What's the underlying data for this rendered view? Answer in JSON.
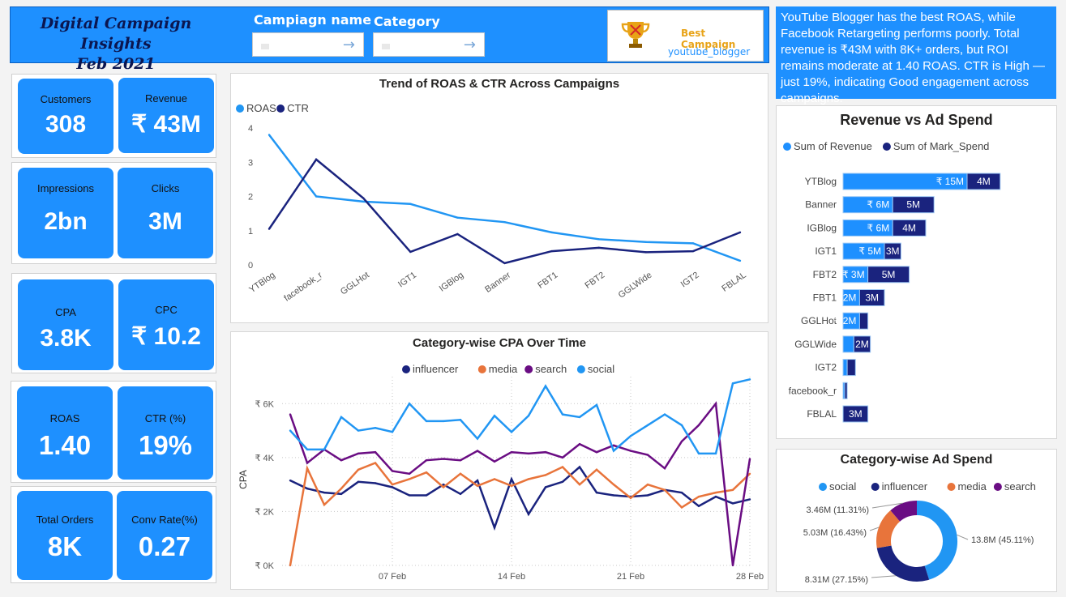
{
  "header": {
    "title_line1": "Digital Campaign Insights",
    "title_line2": "Feb 2021",
    "slicer_campaign_label": "Campiagn name",
    "slicer_category_label": "Category",
    "best_campaign_label": "Best Campaign",
    "best_campaign_value": "youtube_blogger"
  },
  "insight_text": "YouTube Blogger has the best ROAS, while Facebook Retargeting performs poorly. Total revenue is ₹43M with 8K+ orders, but ROI remains moderate at 1.40 ROAS. CTR is High — just 19%, indicating Good engagement across campaigns.",
  "kpis": {
    "customers": {
      "label": "Customers",
      "value": "308"
    },
    "revenue": {
      "label": "Revenue",
      "value": "₹ 43M"
    },
    "impressions": {
      "label": "Impressions",
      "value": "2bn"
    },
    "clicks": {
      "label": "Clicks",
      "value": "3M"
    },
    "cpa": {
      "label": "CPA",
      "value": "3.8K"
    },
    "cpc": {
      "label": "CPC",
      "value": "₹ 10.2"
    },
    "roas": {
      "label": "ROAS",
      "value": "1.40"
    },
    "ctr": {
      "label": "CTR (%)",
      "value": "19%"
    },
    "orders": {
      "label": "Total Orders",
      "value": "8K"
    },
    "conv": {
      "label": "Conv Rate(%)",
      "value": "0.27"
    }
  },
  "colors": {
    "accent": "#1e90ff",
    "dark_blue": "#1a237e",
    "orange": "#e8743b",
    "purple": "#6a0d83",
    "light_blue": "#2196f3"
  },
  "chart_data": [
    {
      "type": "line",
      "title": "Trend of ROAS & CTR Across Campaigns",
      "categories": [
        "YTBlog",
        "facebook_r",
        "GGLHot",
        "IGT1",
        "IGBlog",
        "Banner",
        "FBT1",
        "FBT2",
        "GGLWide",
        "IGT2",
        "FBLAL"
      ],
      "series": [
        {
          "name": "ROAS",
          "color": "#2196f3",
          "values": [
            3.8,
            2.0,
            1.85,
            1.78,
            1.38,
            1.25,
            0.95,
            0.75,
            0.67,
            0.63,
            0.12
          ]
        },
        {
          "name": "CTR",
          "color": "#1a237e",
          "values": [
            1.05,
            3.08,
            1.95,
            0.38,
            0.9,
            0.05,
            0.4,
            0.5,
            0.37,
            0.4,
            0.95
          ]
        }
      ],
      "ylim": [
        0,
        4
      ],
      "yticks": [
        "0",
        "1",
        "2",
        "3",
        "4"
      ],
      "legend": "top-left"
    },
    {
      "type": "line",
      "title": "Category-wise CPA Over Time",
      "ylabel": "CPA",
      "x": [
        1,
        2,
        3,
        4,
        5,
        6,
        7,
        8,
        9,
        10,
        11,
        12,
        13,
        14,
        15,
        16,
        17,
        18,
        19,
        20,
        21,
        22,
        23,
        24,
        25,
        26,
        27,
        28
      ],
      "xticks": [
        {
          "day": 7,
          "label": "07 Feb"
        },
        {
          "day": 14,
          "label": "14 Feb"
        },
        {
          "day": 21,
          "label": "21 Feb"
        },
        {
          "day": 28,
          "label": "28 Feb"
        }
      ],
      "yticks": [
        {
          "v": 0,
          "label": "₹ 0K"
        },
        {
          "v": 2000,
          "label": "₹ 2K"
        },
        {
          "v": 4000,
          "label": "₹ 4K"
        },
        {
          "v": 6000,
          "label": "₹ 6K"
        }
      ],
      "ylim": [
        0,
        7000
      ],
      "legend": "top-center",
      "series": [
        {
          "name": "influencer",
          "color": "#1a237e",
          "values": [
            3150,
            2850,
            2700,
            2650,
            3100,
            3050,
            2900,
            2600,
            2600,
            3000,
            2650,
            3150,
            1400,
            3200,
            1900,
            2900,
            3100,
            3650,
            2700,
            2600,
            2550,
            2600,
            2800,
            2700,
            2200,
            2550,
            2300,
            2450
          ]
        },
        {
          "name": "media",
          "color": "#e8743b",
          "values": [
            0,
            3600,
            2250,
            2850,
            3550,
            3800,
            3000,
            3200,
            3450,
            2900,
            3400,
            2950,
            3200,
            2950,
            3200,
            3350,
            3650,
            3000,
            3550,
            3000,
            2500,
            3000,
            2800,
            2150,
            2550,
            2700,
            2800,
            3400
          ]
        },
        {
          "name": "search",
          "color": "#6a0d83",
          "values": [
            5600,
            3800,
            4300,
            3900,
            4150,
            4200,
            3500,
            3400,
            3900,
            3950,
            3900,
            4250,
            3850,
            4200,
            4150,
            4200,
            4000,
            4500,
            4200,
            4450,
            4250,
            4100,
            3600,
            4600,
            5200,
            6000,
            0,
            3950
          ]
        },
        {
          "name": "social",
          "color": "#2196f3",
          "values": [
            5000,
            4300,
            4300,
            5500,
            5000,
            5100,
            4950,
            6000,
            5350,
            5350,
            5400,
            4700,
            5550,
            4950,
            5550,
            6650,
            5600,
            5500,
            5950,
            4250,
            4800,
            5200,
            5600,
            5200,
            4150,
            4150,
            6750,
            6900
          ]
        }
      ]
    },
    {
      "type": "bar",
      "title": "Revenue vs Ad Spend",
      "categories": [
        "YTBlog",
        "Banner",
        "IGBlog",
        "IGT1",
        "FBT2",
        "FBT1",
        "GGLHot",
        "GGLWide",
        "IGT2",
        "facebook_r",
        "FBLAL"
      ],
      "series": [
        {
          "name": "Sum of Revenue",
          "color": "#1e90ff",
          "values": [
            15,
            6,
            6,
            5,
            3,
            2,
            2,
            1.3,
            0.5,
            0.2,
            0
          ],
          "labels": [
            "₹ 15M",
            "₹ 6M",
            "₹ 6M",
            "₹ 5M",
            "₹ 3M",
            "₹ 2M",
            "₹ 2M",
            "",
            "",
            "",
            ""
          ]
        },
        {
          "name": "Sum of Mark_Spend",
          "color": "#1a237e",
          "values": [
            4,
            5,
            4,
            2,
            5,
            3,
            1,
            2,
            1,
            0.3,
            3
          ],
          "labels": [
            "4M",
            "5M",
            "4M",
            "3M",
            "5M",
            "3M",
            "",
            "2M",
            "",
            "",
            "3M"
          ]
        }
      ],
      "legend": "top"
    },
    {
      "type": "pie",
      "title": "Category-wise Ad Spend",
      "donut": true,
      "slices": [
        {
          "name": "social",
          "value": 13.8,
          "label": "13.8M (45.11%)",
          "color": "#2196f3"
        },
        {
          "name": "influencer",
          "value": 8.31,
          "label": "8.31M (27.15%)",
          "color": "#1a237e"
        },
        {
          "name": "media",
          "value": 5.03,
          "label": "5.03M (16.43%)",
          "color": "#e8743b"
        },
        {
          "name": "search",
          "value": 3.46,
          "label": "3.46M (11.31%)",
          "color": "#6a0d83"
        }
      ],
      "legend": "top"
    }
  ]
}
